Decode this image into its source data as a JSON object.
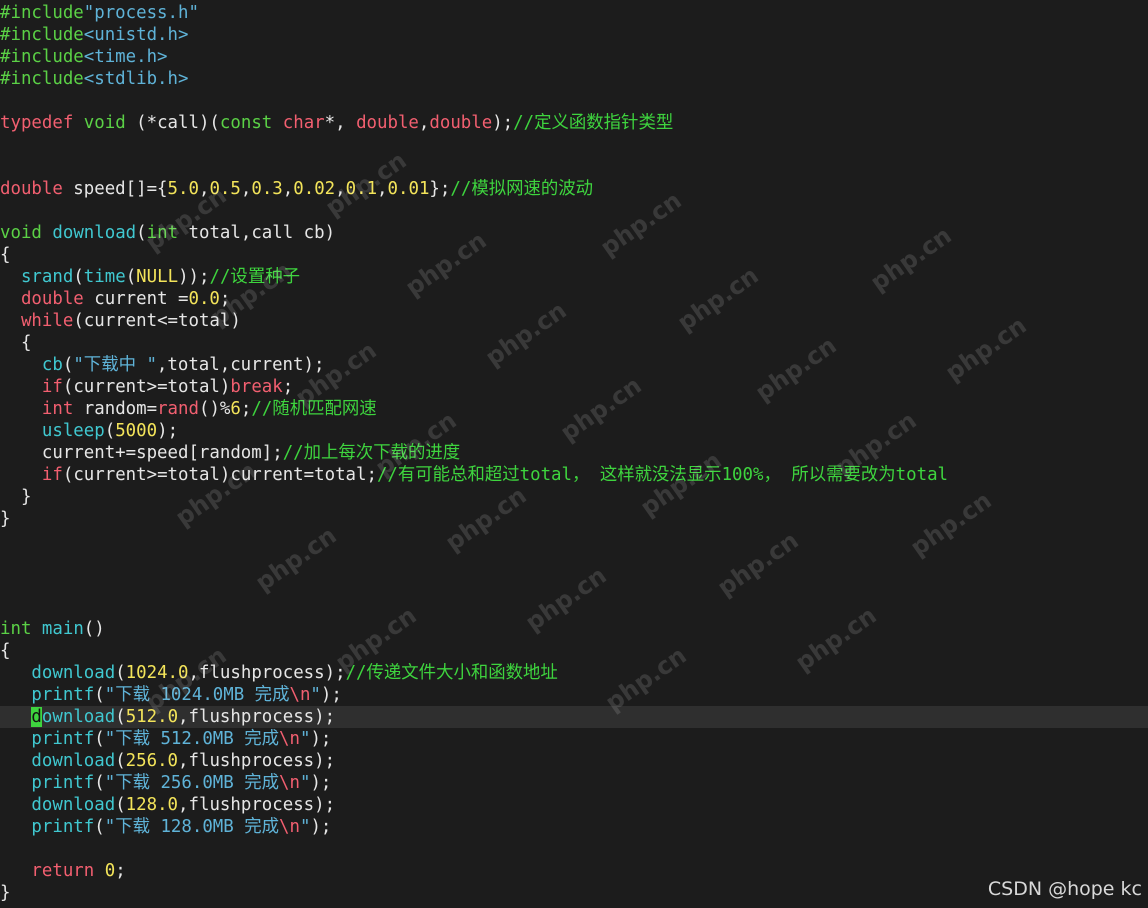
{
  "code": {
    "l1": [
      [
        "pp",
        "#include"
      ],
      [
        "str",
        "\"process.h\""
      ]
    ],
    "l2": [
      [
        "pp",
        "#include"
      ],
      [
        "str",
        "<unistd.h>"
      ]
    ],
    "l3": [
      [
        "pp",
        "#include"
      ],
      [
        "str",
        "<time.h>"
      ]
    ],
    "l4": [
      [
        "pp",
        "#include"
      ],
      [
        "str",
        "<stdlib.h>"
      ]
    ],
    "l5": [],
    "l6": [
      [
        "kw",
        "typedef"
      ],
      [
        "pl",
        " "
      ],
      [
        "ty",
        "void"
      ],
      [
        "pl",
        " (*call)("
      ],
      [
        "ty",
        "const"
      ],
      [
        "pl",
        " "
      ],
      [
        "kw",
        "char"
      ],
      [
        "pl",
        "*, "
      ],
      [
        "kw",
        "double"
      ],
      [
        "pl",
        ","
      ],
      [
        "kw",
        "double"
      ],
      [
        "pl",
        ");"
      ],
      [
        "cm",
        "//定义函数指针类型"
      ]
    ],
    "l7": [],
    "l8": [],
    "l9": [
      [
        "kw",
        "double"
      ],
      [
        "pl",
        " speed[]={"
      ],
      [
        "num",
        "5.0"
      ],
      [
        "pl",
        ","
      ],
      [
        "num",
        "0.5"
      ],
      [
        "pl",
        ","
      ],
      [
        "num",
        "0.3"
      ],
      [
        "pl",
        ","
      ],
      [
        "num",
        "0.02"
      ],
      [
        "pl",
        ","
      ],
      [
        "num",
        "0.1"
      ],
      [
        "pl",
        ","
      ],
      [
        "num",
        "0.01"
      ],
      [
        "pl",
        "};"
      ],
      [
        "cm",
        "//模拟网速的波动"
      ]
    ],
    "l10": [],
    "l11": [
      [
        "ty",
        "void"
      ],
      [
        "pl",
        " "
      ],
      [
        "fn",
        "download"
      ],
      [
        "pl",
        "("
      ],
      [
        "ty",
        "int"
      ],
      [
        "pl",
        " total,call cb)"
      ]
    ],
    "l12": [
      [
        "pl",
        "{"
      ]
    ],
    "l13": [
      [
        "pl",
        "  "
      ],
      [
        "fn",
        "srand"
      ],
      [
        "pl",
        "("
      ],
      [
        "fn",
        "time"
      ],
      [
        "pl",
        "("
      ],
      [
        "num",
        "NULL"
      ],
      [
        "pl",
        "));"
      ],
      [
        "cm",
        "//设置种子"
      ]
    ],
    "l14": [
      [
        "pl",
        "  "
      ],
      [
        "kw",
        "double"
      ],
      [
        "pl",
        " current ="
      ],
      [
        "num",
        "0.0"
      ],
      [
        "pl",
        ";"
      ]
    ],
    "l15": [
      [
        "pl",
        "  "
      ],
      [
        "kw",
        "while"
      ],
      [
        "pl",
        "(current<=total)"
      ]
    ],
    "l16": [
      [
        "pl",
        "  {"
      ]
    ],
    "l17": [
      [
        "pl",
        "    "
      ],
      [
        "fn",
        "cb"
      ],
      [
        "pl",
        "("
      ],
      [
        "str",
        "\"下载中 \""
      ],
      [
        "pl",
        ",total,current);"
      ]
    ],
    "l18": [
      [
        "pl",
        "    "
      ],
      [
        "kw",
        "if"
      ],
      [
        "pl",
        "(current>=total)"
      ],
      [
        "kw",
        "break"
      ],
      [
        "pl",
        ";"
      ]
    ],
    "l19": [
      [
        "pl",
        "    "
      ],
      [
        "kw",
        "int"
      ],
      [
        "pl",
        " random="
      ],
      [
        "kw",
        "rand"
      ],
      [
        "pl",
        "()%"
      ],
      [
        "num",
        "6"
      ],
      [
        "pl",
        ";"
      ],
      [
        "cm",
        "//随机匹配网速"
      ]
    ],
    "l20": [
      [
        "pl",
        "    "
      ],
      [
        "fn",
        "usleep"
      ],
      [
        "pl",
        "("
      ],
      [
        "num",
        "5000"
      ],
      [
        "pl",
        ");"
      ]
    ],
    "l21": [
      [
        "pl",
        "    current+=speed[random];"
      ],
      [
        "cm",
        "//加上每次下载的进度"
      ]
    ],
    "l22": [
      [
        "pl",
        "    "
      ],
      [
        "kw",
        "if"
      ],
      [
        "pl",
        "(current>=total)current=total;"
      ],
      [
        "cm",
        "//有可能总和超过total， 这样就没法显示100%， 所以需要改为total"
      ]
    ],
    "l23": [
      [
        "pl",
        "  }"
      ]
    ],
    "l24": [
      [
        "pl",
        "}"
      ]
    ],
    "l25": [],
    "l26": [],
    "l27": [],
    "l28": [],
    "l29": [
      [
        "ty",
        "int"
      ],
      [
        "pl",
        " "
      ],
      [
        "fn",
        "main"
      ],
      [
        "pl",
        "()"
      ]
    ],
    "l30": [
      [
        "pl",
        "{"
      ]
    ],
    "l31": [
      [
        "pl",
        "   "
      ],
      [
        "fn",
        "download"
      ],
      [
        "pl",
        "("
      ],
      [
        "num",
        "1024.0"
      ],
      [
        "pl",
        ",flushprocess);"
      ],
      [
        "cm",
        "//传递文件大小和函数地址"
      ]
    ],
    "l32": [
      [
        "pl",
        "   "
      ],
      [
        "fn",
        "printf"
      ],
      [
        "pl",
        "("
      ],
      [
        "str",
        "\"下载 1024.0MB 完成"
      ],
      [
        "esc",
        "\\n"
      ],
      [
        "str",
        "\""
      ],
      [
        "pl",
        ");"
      ]
    ],
    "l33": [
      [
        "pl",
        "   "
      ],
      [
        "cursor",
        "d"
      ],
      [
        "fn",
        "ownload"
      ],
      [
        "pl",
        "("
      ],
      [
        "num",
        "512.0"
      ],
      [
        "pl",
        ",flushprocess);"
      ]
    ],
    "l34": [
      [
        "pl",
        "   "
      ],
      [
        "fn",
        "printf"
      ],
      [
        "pl",
        "("
      ],
      [
        "str",
        "\"下载 512.0MB 完成"
      ],
      [
        "esc",
        "\\n"
      ],
      [
        "str",
        "\""
      ],
      [
        "pl",
        ");"
      ]
    ],
    "l35": [
      [
        "pl",
        "   "
      ],
      [
        "fn",
        "download"
      ],
      [
        "pl",
        "("
      ],
      [
        "num",
        "256.0"
      ],
      [
        "pl",
        ",flushprocess);"
      ]
    ],
    "l36": [
      [
        "pl",
        "   "
      ],
      [
        "fn",
        "printf"
      ],
      [
        "pl",
        "("
      ],
      [
        "str",
        "\"下载 256.0MB 完成"
      ],
      [
        "esc",
        "\\n"
      ],
      [
        "str",
        "\""
      ],
      [
        "pl",
        ");"
      ]
    ],
    "l37": [
      [
        "pl",
        "   "
      ],
      [
        "fn",
        "download"
      ],
      [
        "pl",
        "("
      ],
      [
        "num",
        "128.0"
      ],
      [
        "pl",
        ",flushprocess);"
      ]
    ],
    "l38": [
      [
        "pl",
        "   "
      ],
      [
        "fn",
        "printf"
      ],
      [
        "pl",
        "("
      ],
      [
        "str",
        "\"下载 128.0MB 完成"
      ],
      [
        "esc",
        "\\n"
      ],
      [
        "str",
        "\""
      ],
      [
        "pl",
        ");"
      ]
    ],
    "l39": [],
    "l40": [
      [
        "pl",
        "   "
      ],
      [
        "kw",
        "return"
      ],
      [
        "pl",
        " "
      ],
      [
        "num",
        "0"
      ],
      [
        "pl",
        ";"
      ]
    ],
    "l41": [
      [
        "pl",
        "}"
      ]
    ]
  },
  "watermark_text": "php.cn",
  "credit": "CSDN @hope kc",
  "colors": {
    "background": "#1c1c1c",
    "current_line": "#2f2f2f",
    "preprocessor": "#5bd146",
    "string": "#5fb3d8",
    "keyword": "#f25f70",
    "function": "#40c8d0",
    "number": "#f3e45a",
    "comment": "#3ed43e",
    "plain": "#e6e6e6"
  }
}
